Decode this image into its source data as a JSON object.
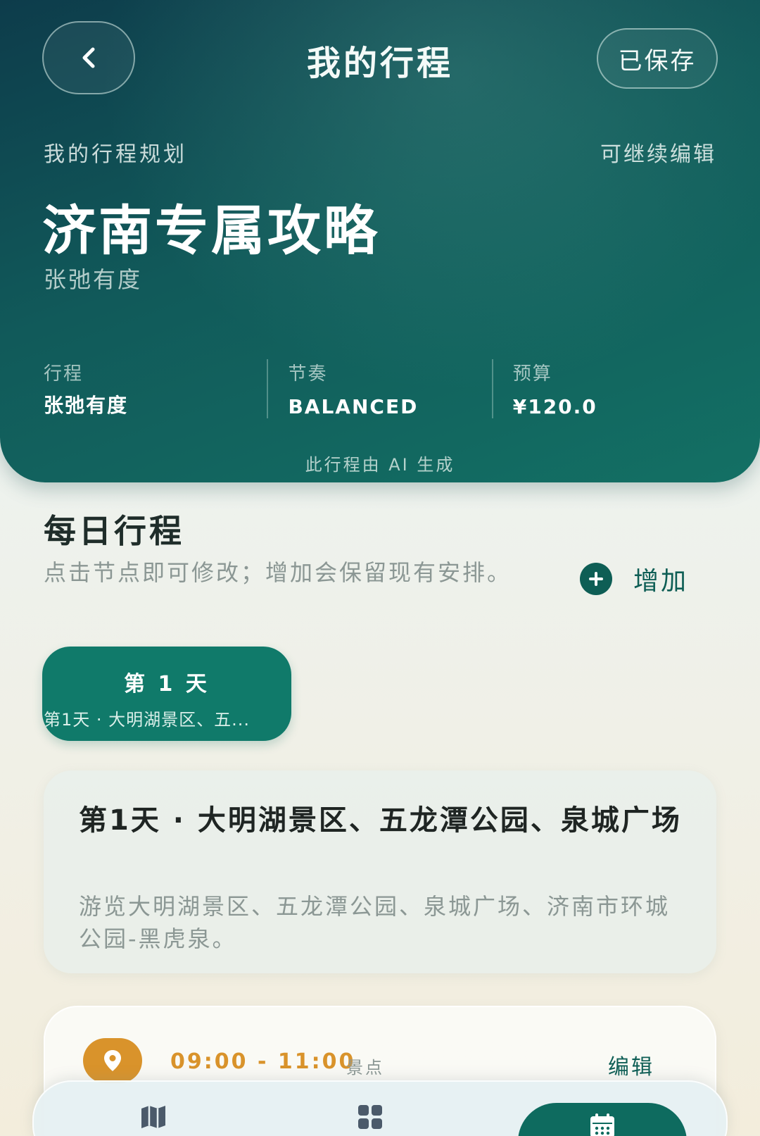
{
  "header": {
    "title": "我的行程",
    "back_icon": "chevron-left-icon",
    "saved_label": "已保存",
    "plan_label": "我的行程规划",
    "edit_hint": "可继续编辑",
    "guide_title": "济南专属攻略",
    "guide_subtitle": "张弛有度",
    "stats": [
      {
        "label": "行程",
        "value": "张弛有度"
      },
      {
        "label": "节奏",
        "value": "BALANCED"
      },
      {
        "label": "预算",
        "value": "¥120.0"
      }
    ],
    "ai_note": "此行程由 AI 生成",
    "colors": {
      "gradient_start": "#0d3c4b",
      "gradient_end": "#137064"
    }
  },
  "daily": {
    "title": "每日行程",
    "description": "点击节点即可修改；增加会保留现有安排。",
    "add_label": "增加",
    "add_icon": "plus-circle-icon",
    "tabs": [
      {
        "title": "第 1 天",
        "subtitle": "第1天 · 大明湖景区、五..."
      }
    ],
    "day_card": {
      "title": "第1天 · 大明湖景区、五龙潭公园、泉城广场",
      "description": "游览大明湖景区、五龙潭公园、泉城广场、济南市环城公园-黑虎泉。"
    },
    "activity": {
      "icon": "location-pin-icon",
      "time": "09:00 - 11:00",
      "type": "景点",
      "edit_label": "编辑"
    }
  },
  "bottom_nav": {
    "items": [
      {
        "icon": "map-icon",
        "active": false
      },
      {
        "icon": "grid-icon",
        "active": false
      },
      {
        "icon": "calendar-icon",
        "active": true
      }
    ]
  },
  "colors": {
    "primary": "#0e5e55",
    "tab_active": "#107a6a",
    "accent_orange": "#d9932b",
    "muted_text": "#8b9794"
  }
}
